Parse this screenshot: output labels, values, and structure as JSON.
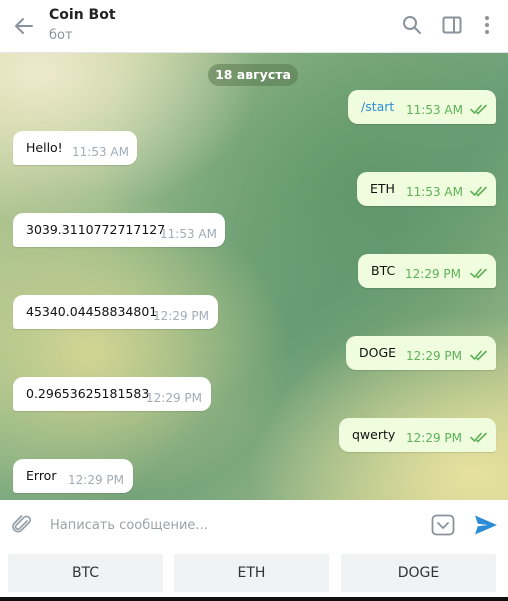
{
  "header": {
    "title": "Coin Bot",
    "subtitle": "бот"
  },
  "chat": {
    "date": "18 августа",
    "messages": [
      {
        "dir": "out",
        "text": "/start",
        "time": "11:53 AM",
        "is_command": true
      },
      {
        "dir": "in",
        "text": "Hello!",
        "time": "11:53 AM"
      },
      {
        "dir": "out",
        "text": "ETH",
        "time": "11:53 AM"
      },
      {
        "dir": "in",
        "text": "3039.3110772717127",
        "time": "11:53 AM"
      },
      {
        "dir": "out",
        "text": "BTC",
        "time": "12:29 PM"
      },
      {
        "dir": "in",
        "text": "45340.04458834801",
        "time": "12:29 PM"
      },
      {
        "dir": "out",
        "text": "DOGE",
        "time": "12:29 PM"
      },
      {
        "dir": "in",
        "text": "0.29653625181583",
        "time": "12:29 PM"
      },
      {
        "dir": "out",
        "text": "qwerty",
        "time": "12:29 PM"
      },
      {
        "dir": "in",
        "text": "Error",
        "time": "12:29 PM"
      }
    ]
  },
  "composer": {
    "placeholder": "Написать сообщение...",
    "value": ""
  },
  "keyboard": {
    "buttons": [
      "BTC",
      "ETH",
      "DOGE"
    ]
  },
  "colors": {
    "accent": "#2d8cd6",
    "outgoing_bubble": "#effdde",
    "read_ticks": "#5eb157",
    "header_icons": "#8a939b"
  },
  "icons": {
    "back": "arrow-left-icon",
    "search": "search-icon",
    "sidebar": "sidebar-toggle-icon",
    "menu": "more-vertical-icon",
    "attach": "paperclip-icon",
    "keyboard": "bot-keyboard-icon",
    "send": "send-icon",
    "read": "double-check-icon"
  }
}
